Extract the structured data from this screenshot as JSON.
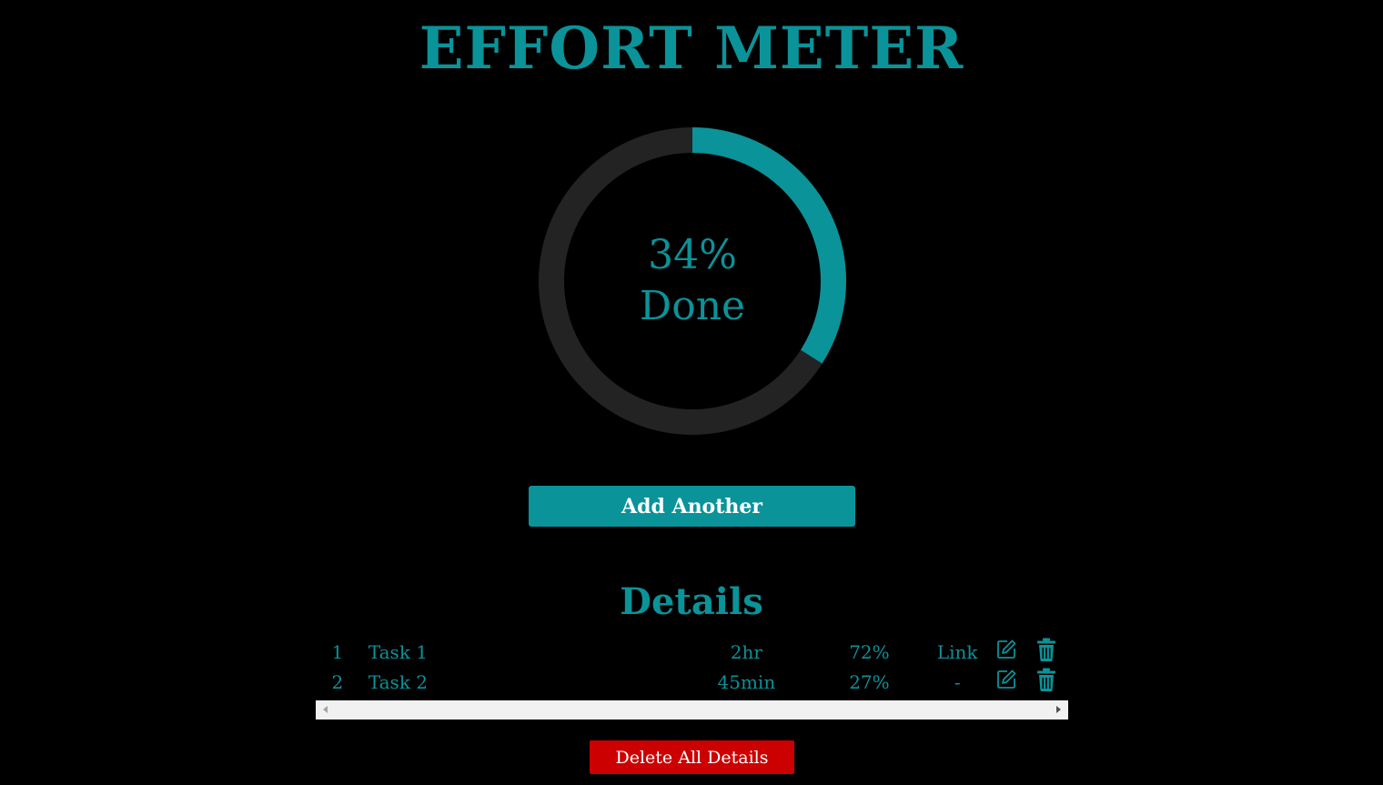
{
  "title": "EFFORT METER",
  "colors": {
    "accent": "#0a9399",
    "track": "#232323",
    "background": "#000000",
    "danger": "#cc0000"
  },
  "meter": {
    "percent": 34,
    "percent_label": "34%",
    "status_label": "Done"
  },
  "add_button_label": "Add Another",
  "details": {
    "heading": "Details",
    "rows": [
      {
        "num": "1",
        "name": "Task 1",
        "time": "2hr",
        "pct": "72%",
        "link": "Link"
      },
      {
        "num": "2",
        "name": "Task 2",
        "time": "45min",
        "pct": "27%",
        "link": "-"
      }
    ]
  },
  "delete_all_label": "Delete All Details"
}
